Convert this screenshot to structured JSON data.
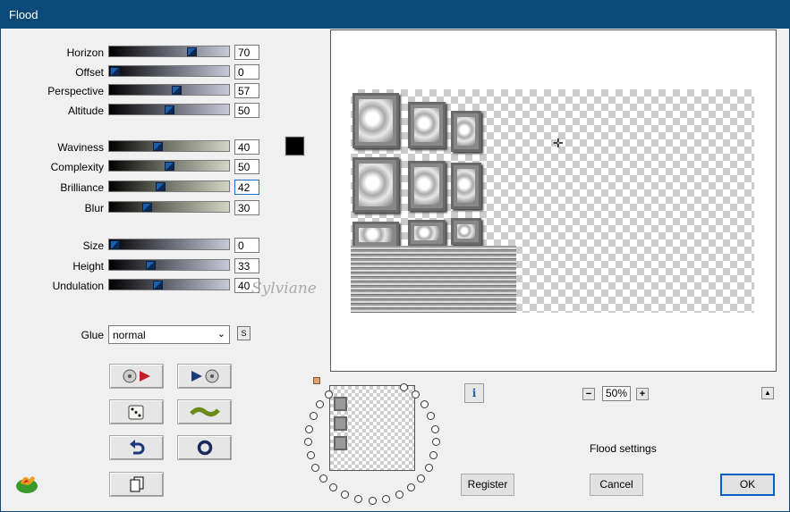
{
  "window": {
    "title": "Flood"
  },
  "params": {
    "horizon": {
      "label": "Horizon",
      "value": "70"
    },
    "offset": {
      "label": "Offset",
      "value": "0"
    },
    "perspective": {
      "label": "Perspective",
      "value": "57"
    },
    "altitude": {
      "label": "Altitude",
      "value": "50"
    },
    "waviness": {
      "label": "Waviness",
      "value": "40"
    },
    "complexity": {
      "label": "Complexity",
      "value": "50"
    },
    "brilliance": {
      "label": "Brilliance",
      "value": "42"
    },
    "blur": {
      "label": "Blur",
      "value": "30"
    },
    "size": {
      "label": "Size",
      "value": "0"
    },
    "height": {
      "label": "Height",
      "value": "33"
    },
    "undulation": {
      "label": "Undulation",
      "value": "40"
    }
  },
  "glue": {
    "label": "Glue",
    "value": "normal",
    "s_label": "S"
  },
  "color_swatch": "#000000",
  "watermark": "Sylviane",
  "zoom": {
    "minus": "−",
    "value": "50%",
    "plus": "+"
  },
  "info_label": "i",
  "status": "Flood settings",
  "buttons": {
    "register": "Register",
    "cancel": "Cancel",
    "ok": "OK"
  },
  "icons": [
    "load-preset-icon",
    "save-preset-icon",
    "random-dice-icon",
    "wave-icon",
    "undo-icon",
    "reset-icon",
    "copy-icon",
    "app-logo-icon",
    "info-icon",
    "crosshair-icon"
  ]
}
